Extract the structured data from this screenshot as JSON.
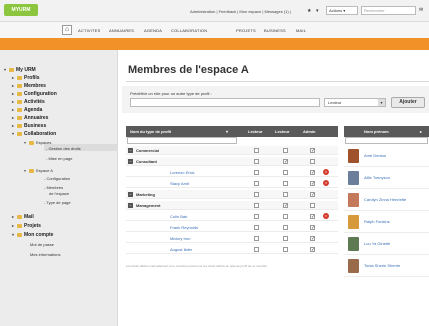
{
  "header": {
    "logo_text": "MYURM",
    "info": "Administration | Feedback | Mon espace | Messages (1) |",
    "actions_label": "Actions",
    "search_placeholder": "Rechercher"
  },
  "nav": {
    "items": [
      "ACTIVITES",
      "ANNUAIRES",
      "AGENDA",
      "COLLABORATION",
      "PROJETS",
      "BUSINESS",
      "MAIL"
    ]
  },
  "sidebar": {
    "items": [
      {
        "label": "My URM",
        "level": 0
      },
      {
        "label": "Profils",
        "level": 1
      },
      {
        "label": "Membres",
        "level": 1
      },
      {
        "label": "Configuration",
        "level": 1
      },
      {
        "label": "Activités",
        "level": 1
      },
      {
        "label": "Agenda",
        "level": 1
      },
      {
        "label": "Annuaires",
        "level": 1
      },
      {
        "label": "Business",
        "level": 1
      },
      {
        "label": "Collaboration",
        "level": 1
      },
      {
        "label": "Espaces",
        "level": 2
      },
      {
        "label": "- Gestion des droits",
        "level": 3
      },
      {
        "label": "- Mise en page",
        "level": 3
      },
      {
        "label": "Espace A",
        "level": 2
      },
      {
        "label": "- Configuration",
        "level": 3
      },
      {
        "label": "- Membres",
        "level": 3
      },
      {
        "label": "de l'espace",
        "level": 3
      },
      {
        "label": "- Type de page",
        "level": 3
      },
      {
        "label": "Mail",
        "level": 1
      },
      {
        "label": "Projets",
        "level": 1
      },
      {
        "label": "Mon compte",
        "level": 1
      },
      {
        "label": "Mot de passe",
        "level": 2
      },
      {
        "label": "Mes informations",
        "level": 2
      }
    ]
  },
  "main": {
    "title": "Membres de l'espace A",
    "form": {
      "label": "Prédéfinir un rôle pour un autre type de profil :",
      "input_value": "",
      "select_value": "Lecteur",
      "add_button": "Ajouter"
    },
    "table": {
      "headers": [
        "Nom du type de profil",
        "Lecteur",
        "Lecteur",
        "Admin"
      ],
      "rows": [
        {
          "label": "Commercial",
          "group": true,
          "checks": [
            false,
            false,
            true
          ],
          "del": false
        },
        {
          "label": "Consultant",
          "group": true,
          "checks": [
            false,
            true,
            false
          ],
          "del": false
        },
        {
          "label": "Lorenzo Erick",
          "group": false,
          "checks": [
            false,
            false,
            true
          ],
          "del": true
        },
        {
          "label": "Stacy Amit",
          "group": false,
          "checks": [
            false,
            false,
            true
          ],
          "del": true
        },
        {
          "label": "Marketing",
          "group": true,
          "checks": [
            false,
            false,
            true
          ],
          "del": false
        },
        {
          "label": "Management",
          "group": true,
          "checks": [
            false,
            true,
            false
          ],
          "del": false
        },
        {
          "label": "Colin Bab",
          "group": false,
          "checks": [
            false,
            false,
            true
          ],
          "del": true
        },
        {
          "label": "Frank Reynolds",
          "group": false,
          "checks": [
            false,
            false,
            true
          ],
          "del": false
        },
        {
          "label": "Mickey Iron",
          "group": false,
          "checks": [
            false,
            false,
            true
          ],
          "del": false
        },
        {
          "label": "August Ikiter",
          "group": false,
          "checks": [
            false,
            false,
            true
          ],
          "del": false
        }
      ]
    },
    "members": {
      "header": "Nom prénom",
      "list": [
        {
          "name": "Amé Denton",
          "color": "#a0522d"
        },
        {
          "name": "Alfie Tonnyson",
          "color": "#6b7f9a"
        },
        {
          "name": "Carolyn Zinna Henriette",
          "color": "#c47a5a"
        },
        {
          "name": "Ralph Fonkins",
          "color": "#d69a3a"
        },
        {
          "name": "Lou Ya Ginette",
          "color": "#5f7a52"
        },
        {
          "name": "Tonia Sherie Sherrie",
          "color": "#9a6b4b"
        }
      ]
    },
    "footnote": "Les droits définis manuellement à un membre prévent sur les droits définis au type de profil de ce membre"
  },
  "colors": {
    "accent": "#f39129",
    "header_dark": "#5a5a5a",
    "link": "#3a6fb5",
    "logo_green": "#8cc63e",
    "delete_red": "#d33a2c"
  }
}
